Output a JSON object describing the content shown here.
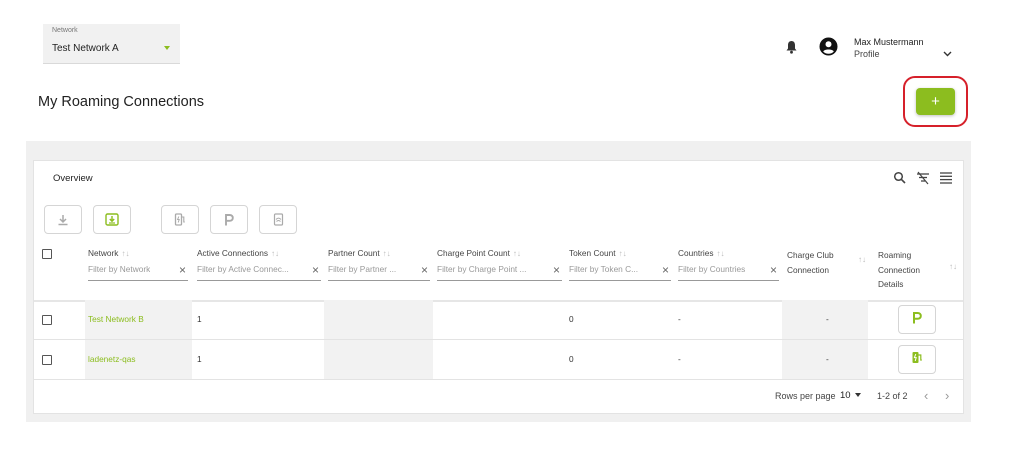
{
  "network": {
    "label": "Network",
    "value": "Test Network A"
  },
  "user": {
    "name": "Max Mustermann",
    "role": "Profile"
  },
  "page_title": "My Roaming Connections",
  "add_button_label": "+",
  "overview_label": "Overview",
  "columns": [
    {
      "title": "Network",
      "filter": "Filter by Network"
    },
    {
      "title": "Active Connections",
      "filter": "Filter by Active Connec..."
    },
    {
      "title": "Partner Count",
      "filter": "Filter by Partner ..."
    },
    {
      "title": "Charge Point Count",
      "filter": "Filter by Charge Point ..."
    },
    {
      "title": "Token Count",
      "filter": "Filter by Token C..."
    },
    {
      "title": "Countries",
      "filter": "Filter by Countries"
    },
    {
      "title_line1": "Charge Club",
      "title_line2": "Connection"
    },
    {
      "title_line1": "Roaming",
      "title_line2": "Connection",
      "title_line3": "Details"
    }
  ],
  "rows": [
    {
      "network": "Test Network B",
      "active_connections": "1",
      "partner_count": "",
      "charge_point_count": "",
      "token_count": "0",
      "countries": "-",
      "charge_club": "-",
      "details_icon": "parking-icon"
    },
    {
      "network": "ladenetz-qas",
      "active_connections": "1",
      "partner_count": "",
      "charge_point_count": "",
      "token_count": "0",
      "countries": "-",
      "charge_club": "-",
      "details_icon": "charging-station-icon"
    }
  ],
  "pagination": {
    "rows_per_page_label": "Rows per page",
    "rows_per_page": "10",
    "range": "1-2 of 2"
  },
  "icons": {
    "filter_clear": "×",
    "prev": "‹",
    "next": "›",
    "sort": "↑↓"
  },
  "colors": {
    "accent": "#8cbd1f",
    "highlight": "#d6202a"
  }
}
